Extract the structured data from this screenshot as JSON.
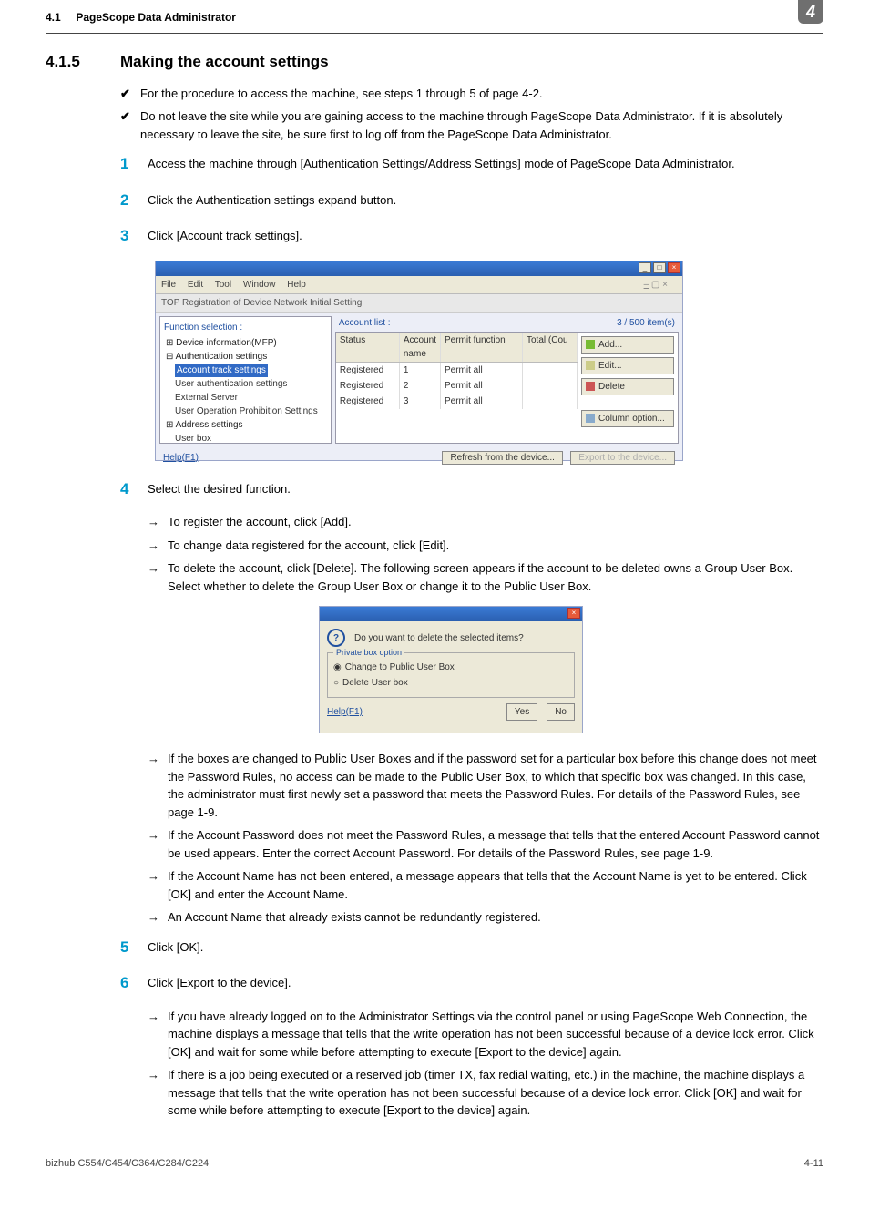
{
  "header": {
    "section_no": "4.1",
    "section_title": "PageScope Data Administrator",
    "chapter_tab": "4"
  },
  "section": {
    "num": "4.1.5",
    "title": "Making the account settings"
  },
  "checks": [
    "For the procedure to access the machine, see steps 1 through 5 of page 4-2.",
    "Do not leave the site while you are gaining access to the machine through PageScope Data Administrator. If it is absolutely necessary to leave the site, be sure first to log off from the PageScope Data Administrator."
  ],
  "steps": {
    "s1": "Access the machine through [Authentication Settings/Address Settings] mode of PageScope Data Administrator.",
    "s2": "Click the Authentication settings expand button.",
    "s3": "Click [Account track settings].",
    "s4": "Select the desired function.",
    "s5": "Click [OK].",
    "s6": "Click [Export to the device]."
  },
  "substeps4": [
    "To register the account, click [Add].",
    "To change data registered for the account, click [Edit].",
    "To delete the account, click [Delete]. The following screen appears if the account to be deleted owns a Group User Box. Select whether to delete the Group User Box or change it to the Public User Box."
  ],
  "substeps4b": [
    "If the boxes are changed to Public User Boxes and if the password set for a particular box before this change does not meet the Password Rules, no access can be made to the Public User Box, to which that specific box was changed. In this case, the administrator must first newly set a password that meets the Password Rules. For details of the Password Rules, see page 1-9.",
    "If the Account Password does not meet the Password Rules, a message that tells that the entered Account Password cannot be used appears. Enter the correct Account Password. For details of the Password Rules, see page 1-9.",
    "If the Account Name has not been entered, a message appears that tells that the Account Name is yet to be entered. Click [OK] and enter the Account Name.",
    "An Account Name that already exists cannot be redundantly registered."
  ],
  "substeps6": [
    "If you have already logged on to the Administrator Settings via the control panel or using PageScope Web Connection, the machine displays a message that tells that the write operation has not been successful because of a device lock error. Click [OK] and wait for some while before attempting to execute [Export to the device] again.",
    "If there is a job being executed or a reserved job (timer TX, fax redial waiting, etc.) in the machine, the machine displays a message that tells that the write operation has not been successful because of a device lock error. Click [OK] and wait for some while before attempting to execute [Export to the device] again."
  ],
  "win1": {
    "menus": [
      "File",
      "Edit",
      "Tool",
      "Window",
      "Help"
    ],
    "toolbar": "TOP   Registration of Device   Network Initial Setting",
    "left_heading": "Function selection :",
    "tree": {
      "root": "Device information(MFP)",
      "auth": "Authentication settings",
      "acct": "Account track settings",
      "uas": "User authentication settings",
      "ext": "External Server",
      "uops": "User Operation Prohibition Settings",
      "addr": "Address settings",
      "ubox": "User box"
    },
    "acct_heading": "Account list :",
    "acct_count": "3 / 500 item(s)",
    "cols": {
      "status": "Status",
      "name": "Account name",
      "func": "Permit function",
      "tot": "Total (Cou"
    },
    "rows": [
      {
        "status": "Registered",
        "name": "1",
        "func": "Permit all"
      },
      {
        "status": "Registered",
        "name": "2",
        "func": "Permit all"
      },
      {
        "status": "Registered",
        "name": "3",
        "func": "Permit all"
      }
    ],
    "btns": {
      "add": "Add...",
      "edit": "Edit...",
      "del": "Delete",
      "col": "Column option..."
    },
    "help": "Help(F1)",
    "refresh": "Refresh from the device...",
    "export": "Export to the device..."
  },
  "dlg": {
    "msg": "Do you want to delete the selected items?",
    "group": "Private box option",
    "opt1": "Change to Public User Box",
    "opt2": "Delete User box",
    "help": "Help(F1)",
    "yes": "Yes",
    "no": "No"
  },
  "footer": {
    "left": "bizhub C554/C454/C364/C284/C224",
    "right": "4-11"
  }
}
